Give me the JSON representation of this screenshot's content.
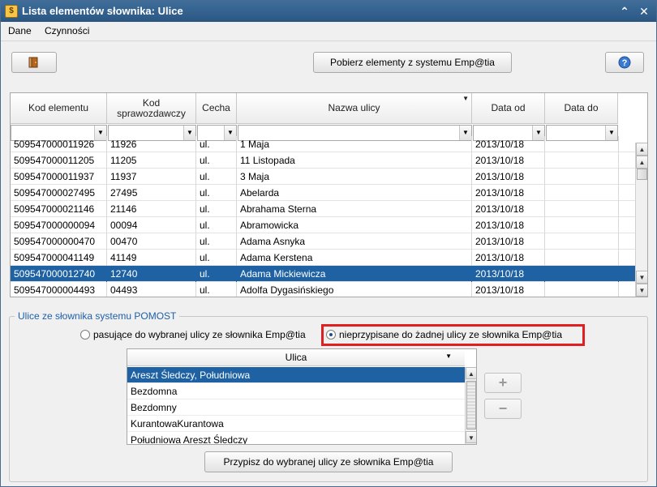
{
  "window": {
    "title": "Lista elementów słownika: Ulice",
    "icon": "dictionary-icon"
  },
  "menu": {
    "items": [
      {
        "label": "Dane",
        "accel": "D"
      },
      {
        "label": "Czynności",
        "accel": "C"
      }
    ]
  },
  "toolbar": {
    "exit_icon": "door-exit-icon",
    "fetch_label": "Pobierz elementy z systemu Emp@tia",
    "help_icon": "help-question-icon"
  },
  "grid": {
    "columns": [
      {
        "label": "Kod elementu"
      },
      {
        "label": "Kod sprawozdawczy"
      },
      {
        "label": "Cecha"
      },
      {
        "label": "Nazwa ulicy"
      },
      {
        "label": "Data od"
      },
      {
        "label": "Data do"
      }
    ],
    "rows": [
      {
        "kod": "509547000011926",
        "spraw": "11926",
        "cecha": "ul.",
        "nazwa": "1 Maja",
        "od": "2013/10/18",
        "do": ""
      },
      {
        "kod": "509547000011205",
        "spraw": "11205",
        "cecha": "ul.",
        "nazwa": "11 Listopada",
        "od": "2013/10/18",
        "do": ""
      },
      {
        "kod": "509547000011937",
        "spraw": "11937",
        "cecha": "ul.",
        "nazwa": "3 Maja",
        "od": "2013/10/18",
        "do": ""
      },
      {
        "kod": "509547000027495",
        "spraw": "27495",
        "cecha": "ul.",
        "nazwa": "Abelarda",
        "od": "2013/10/18",
        "do": ""
      },
      {
        "kod": "509547000021146",
        "spraw": "21146",
        "cecha": "ul.",
        "nazwa": "Abrahama Sterna",
        "od": "2013/10/18",
        "do": ""
      },
      {
        "kod": "509547000000094",
        "spraw": "00094",
        "cecha": "ul.",
        "nazwa": "Abramowicka",
        "od": "2013/10/18",
        "do": ""
      },
      {
        "kod": "509547000000470",
        "spraw": "00470",
        "cecha": "ul.",
        "nazwa": "Adama Asnyka",
        "od": "2013/10/18",
        "do": ""
      },
      {
        "kod": "509547000041149",
        "spraw": "41149",
        "cecha": "ul.",
        "nazwa": "Adama Kerstena",
        "od": "2013/10/18",
        "do": ""
      },
      {
        "kod": "509547000012740",
        "spraw": "12740",
        "cecha": "ul.",
        "nazwa": "Adama Mickiewicza",
        "od": "2013/10/18",
        "do": "",
        "selected": true
      },
      {
        "kod": "509547000004493",
        "spraw": "04493",
        "cecha": "ul.",
        "nazwa": "Adolfa Dygasińskiego",
        "od": "2013/10/18",
        "do": ""
      }
    ]
  },
  "pomost": {
    "legend": "Ulice ze słownika systemu POMOST",
    "radio_matching": "pasujące do wybranej ulicy ze słownika Emp@tia",
    "radio_unassigned": "nieprzypisane do żadnej ulicy ze słownika Emp@tia",
    "selected_radio": "unassigned",
    "list_header": "Ulica",
    "items": [
      {
        "label": "Areszt Śledczy, Południowa",
        "selected": true
      },
      {
        "label": "Bezdomna"
      },
      {
        "label": "Bezdomny"
      },
      {
        "label": "KurantowaKurantowa"
      },
      {
        "label": "Południowa  Areszt  Śledczy"
      }
    ],
    "add_label": "+",
    "remove_label": "−",
    "assign_label": "Przypisz do wybranej ulicy ze słownika Emp@tia"
  },
  "colors": {
    "title_bar": "#2f5f8f",
    "selection": "#1f62a4",
    "highlight": "#e02020",
    "legend": "#1f5fa8"
  }
}
